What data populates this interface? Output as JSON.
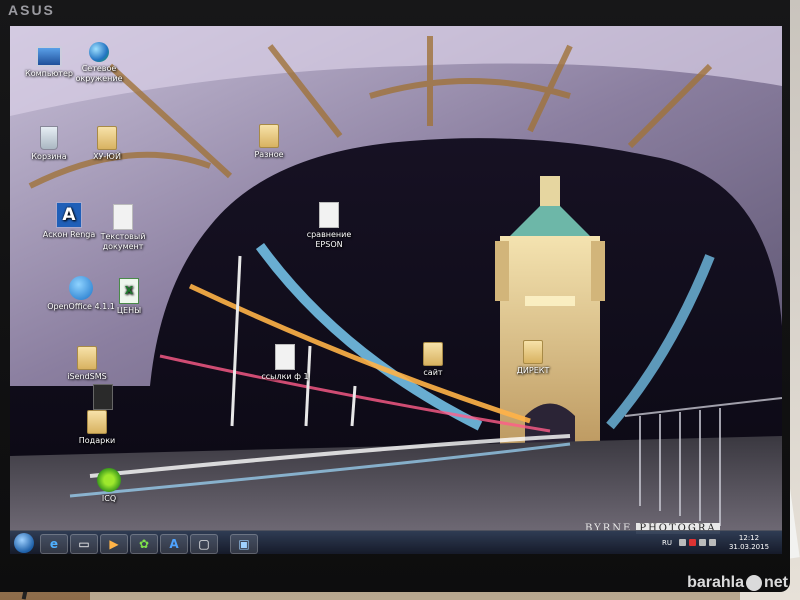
{
  "monitor": {
    "brand": "ASUS"
  },
  "desktop": {
    "icons": [
      {
        "id": "computer",
        "label": "Компьютер",
        "icon": "pc-icon"
      },
      {
        "id": "network",
        "label": "Сетевое окружение",
        "icon": "globe-icon"
      },
      {
        "id": "recycle",
        "label": "Корзина",
        "icon": "recycle-bin-icon"
      },
      {
        "id": "folder-xyu",
        "label": "ХУ-ЮЙ",
        "icon": "folder-icon"
      },
      {
        "id": "raznoe",
        "label": "Разное",
        "icon": "folder-icon"
      },
      {
        "id": "ascon",
        "label": "Аскон Renga",
        "icon": "ascon-icon"
      },
      {
        "id": "textdoc",
        "label": "Текстовый документ",
        "icon": "document-icon"
      },
      {
        "id": "epson",
        "label": "сравнение EPSON",
        "icon": "document-icon"
      },
      {
        "id": "openoffice",
        "label": "OpenOffice 4.1.1",
        "icon": "openoffice-icon"
      },
      {
        "id": "xls",
        "label": "ЦЕНЫ",
        "icon": "spreadsheet-icon"
      },
      {
        "id": "isendsms",
        "label": "iSendSMS",
        "icon": "folder-icon"
      },
      {
        "id": "tower-bridge",
        "label": "",
        "icon": "tower-bridge-icon"
      },
      {
        "id": "podarki",
        "label": "Подарки",
        "icon": "folder-icon"
      },
      {
        "id": "ssylki",
        "label": "ссылки ф 1",
        "icon": "document-icon"
      },
      {
        "id": "sait",
        "label": "сайт",
        "icon": "folder-icon"
      },
      {
        "id": "direkt",
        "label": "ДИРЕКТ",
        "icon": "folder-icon"
      },
      {
        "id": "icq",
        "label": "ICQ",
        "icon": "icq-icon"
      }
    ]
  },
  "wallpaper": {
    "watermark": "BYRNE",
    "watermark_tag": "PHOTOGRA"
  },
  "taskbar": {
    "buttons": [
      {
        "icon": "ie-icon",
        "glyph": "e"
      },
      {
        "icon": "explorer-icon",
        "glyph": "▭"
      },
      {
        "icon": "media-player-icon",
        "glyph": "▶"
      },
      {
        "icon": "icq-taskbar-icon",
        "glyph": "✿"
      },
      {
        "icon": "ascon-taskbar-icon",
        "glyph": "A"
      },
      {
        "icon": "window-icon",
        "glyph": "▢"
      },
      {
        "icon": "display-icon",
        "glyph": "▣"
      }
    ],
    "language": "RU",
    "time": "12:12",
    "date": "31.03.2015"
  },
  "site_watermark": {
    "text_left": "barahla",
    "text_right": "net"
  },
  "colors": {
    "taskbar": "#1f2a40",
    "bezel": "#141415",
    "accent_blue": "#2b7be4"
  }
}
